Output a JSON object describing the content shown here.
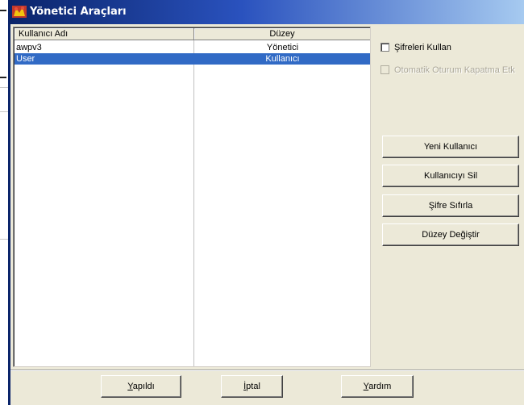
{
  "window": {
    "title": "Yönetici Araçları"
  },
  "user_list": {
    "columns": [
      "Kullanıcı Adı",
      "Düzey"
    ],
    "rows": [
      {
        "name": "awpv3",
        "level": "Yönetici",
        "selected": false
      },
      {
        "name": "User",
        "level": "Kullanıcı",
        "selected": true
      }
    ]
  },
  "options": {
    "use_passwords": {
      "label": "Şifreleri Kullan",
      "checked": false,
      "enabled": true
    },
    "auto_logout": {
      "label": "Otomatik Oturum Kapatma Etk",
      "checked": false,
      "enabled": false
    }
  },
  "actions": {
    "new_user": "Yeni Kullanıcı",
    "delete_user": "Kullanıcıyı Sil",
    "reset_password": "Şifre Sıfırla",
    "change_level": "Düzey Değiştir"
  },
  "footer": {
    "done": {
      "underline": "Y",
      "rest": "apıldı"
    },
    "cancel": {
      "underline": "İ",
      "rest": "ptal"
    },
    "help": {
      "underline": "Y",
      "rest": "ardım"
    }
  },
  "colors": {
    "title_start": "#0a246a",
    "title_end": "#a6caf0",
    "selection": "#316ac5",
    "face": "#ece9d8"
  }
}
